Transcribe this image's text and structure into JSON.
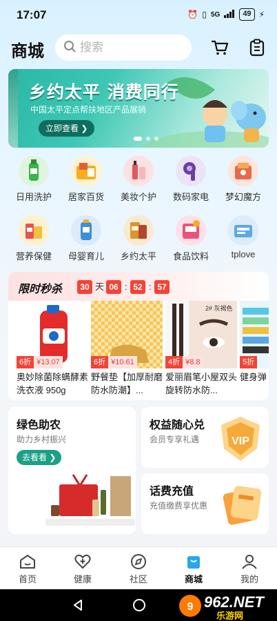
{
  "status": {
    "time": "17:07",
    "network": "5G",
    "battery": "49"
  },
  "header": {
    "title": "商城",
    "search_placeholder": "搜索"
  },
  "banner": {
    "title": "乡约太平 消费同行",
    "subtitle": "中国太平定点帮扶地区产品展销",
    "button": "立即查看"
  },
  "categories": [
    {
      "label": "日用洗护",
      "color": "#39b54a"
    },
    {
      "label": "居家百货",
      "color": "#f2b01e"
    },
    {
      "label": "美妆个护",
      "color": "#e2585d"
    },
    {
      "label": "数码家电",
      "color": "#6b3fa0"
    },
    {
      "label": "梦幻魔方",
      "color": "#e7684a"
    },
    {
      "label": "营养保健",
      "color": "#f0c040"
    },
    {
      "label": "母婴育儿",
      "color": "#3a8fd6"
    },
    {
      "label": "乡约太平",
      "color": "#d9962f"
    },
    {
      "label": "食品饮料",
      "color": "#e7567a"
    },
    {
      "label": "tplove",
      "color": "#5aa9e6"
    }
  ],
  "flash": {
    "title": "限时秒杀",
    "countdown": {
      "days": "30",
      "day_unit": "天",
      "hours": "06",
      "minutes": "52",
      "seconds": "57"
    },
    "products": [
      {
        "discount": "6折",
        "price": "¥13.07",
        "name": "奥妙除菌除螨酵素洗衣液 950g"
      },
      {
        "discount": "6折",
        "price": "¥10.61",
        "name": "野餐垫【加厚耐磨防水防潮】..."
      },
      {
        "discount": "4折",
        "price": "¥8.8",
        "name": "爱丽眉笔小屋双头旋转防水防..."
      },
      {
        "discount": "5折",
        "price": "",
        "name": "健身弹"
      }
    ],
    "product_tags": {
      "tag2": "2# 灰褐色"
    }
  },
  "cards": {
    "green": {
      "title": "绿色助农",
      "subtitle": "助力乡村振兴",
      "button": "去看看"
    },
    "rights": {
      "title": "权益随心兑",
      "subtitle": "会员专享礼遇",
      "badge": "VIP"
    },
    "topup": {
      "title": "话费充值",
      "subtitle": "充值缴费享优惠"
    }
  },
  "tabs": [
    {
      "label": "首页"
    },
    {
      "label": "健康"
    },
    {
      "label": "社区"
    },
    {
      "label": "商城"
    },
    {
      "label": "我的"
    }
  ],
  "watermark": {
    "text": "962.NET",
    "sub": "乐游网"
  }
}
